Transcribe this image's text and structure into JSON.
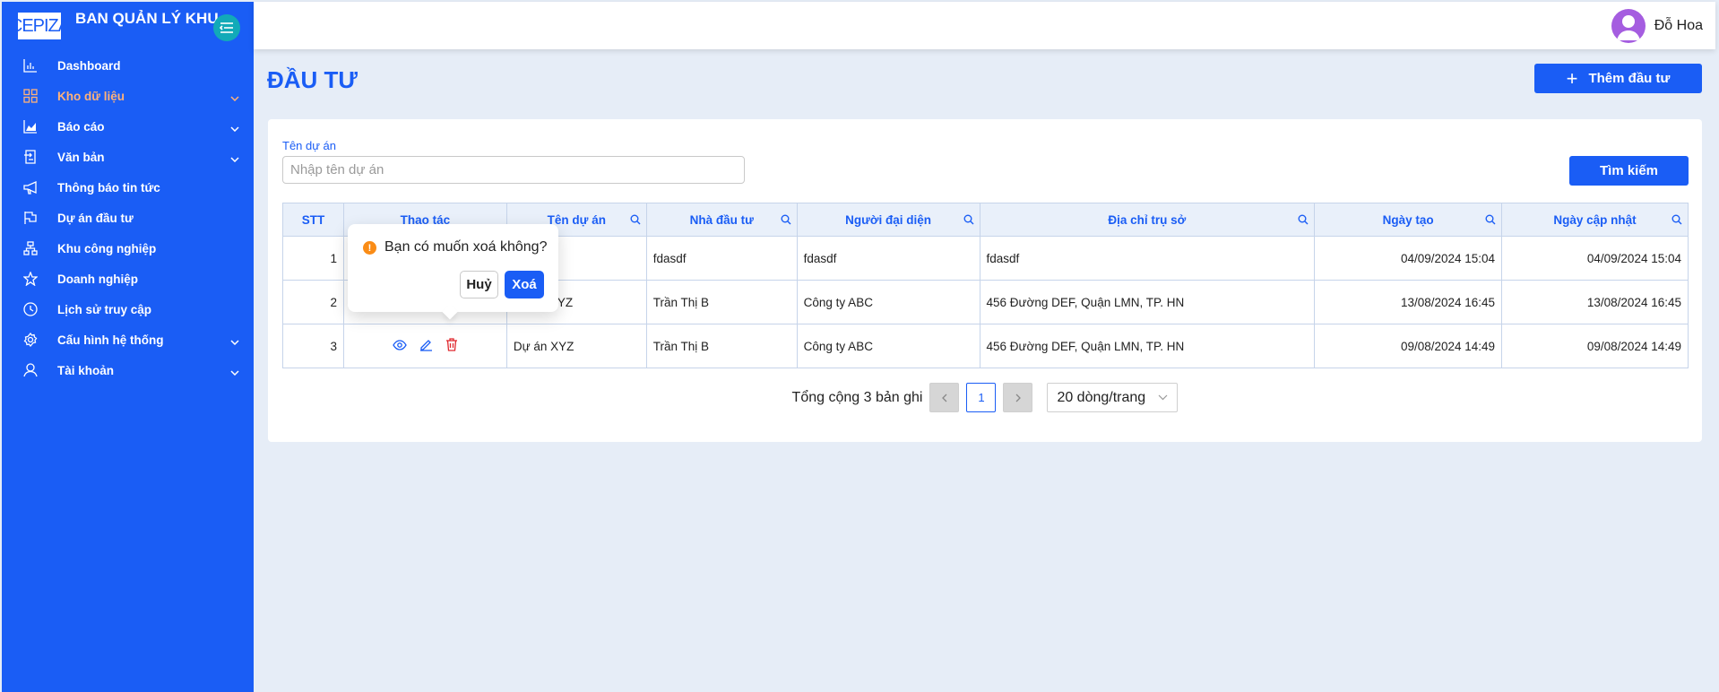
{
  "sidebar": {
    "logo_text": "CEPIZA",
    "brand_title": "BAN QUẢN LÝ KHU CHẾ XUẤT KHU CN",
    "items": [
      {
        "label": "Dashboard",
        "icon": "bar-chart-icon"
      },
      {
        "label": "Kho dữ liệu",
        "icon": "grid-icon",
        "active": true
      },
      {
        "label": "Báo cáo",
        "icon": "area-chart-icon"
      },
      {
        "label": "Văn bản",
        "icon": "document-icon"
      },
      {
        "label": "Thông báo tin tức",
        "icon": "megaphone-icon"
      },
      {
        "label": "Dự án đầu tư",
        "icon": "flag-icon"
      },
      {
        "label": "Khu công nghiệp",
        "icon": "cluster-icon"
      },
      {
        "label": "Doanh nghiệp",
        "icon": "star-icon"
      },
      {
        "label": "Lịch sử truy cập",
        "icon": "clock-icon"
      },
      {
        "label": "Cấu hình hệ thống",
        "icon": "gear-icon"
      },
      {
        "label": "Tài khoản",
        "icon": "user-icon"
      }
    ],
    "accent_color": "#1a5df5",
    "active_color": "#ffb27a"
  },
  "header": {
    "user_name": "Đỗ Hoa"
  },
  "page": {
    "title": "ĐẦU TƯ",
    "add_button": "Thêm đầu tư"
  },
  "filter": {
    "label": "Tên dự án",
    "placeholder": "Nhập tên dự án",
    "value": "",
    "search_button": "Tìm kiếm"
  },
  "table": {
    "columns": [
      "STT",
      "Thao tác",
      "Tên dự án",
      "Nhà đầu tư",
      "Người đại diện",
      "Địa chỉ trụ sở",
      "Ngày tạo",
      "Ngày cập nhật"
    ],
    "rows": [
      {
        "stt": "1",
        "ten_du_an": "",
        "nha_dau_tu": "fdasdf",
        "nguoi_dai_dien": "fdasdf",
        "dia_chi": "fdasdf",
        "ngay_tao": "04/09/2024 15:04",
        "ngay_cap_nhat": "04/09/2024 15:04"
      },
      {
        "stt": "2",
        "ten_du_an": "YZ",
        "nha_dau_tu": "Trần Thị B",
        "nguoi_dai_dien": "Công ty ABC",
        "dia_chi": "456 Đường DEF, Quận LMN, TP. HN",
        "ngay_tao": "13/08/2024 16:45",
        "ngay_cap_nhat": "13/08/2024 16:45"
      },
      {
        "stt": "3",
        "ten_du_an": "Dự án XYZ",
        "nha_dau_tu": "Trần Thị B",
        "nguoi_dai_dien": "Công ty ABC",
        "dia_chi": "456 Đường DEF, Quận LMN, TP. HN",
        "ngay_tao": "09/08/2024 14:49",
        "ngay_cap_nhat": "09/08/2024 14:49"
      }
    ]
  },
  "popconfirm": {
    "message": "Bạn có muốn xoá không?",
    "cancel": "Huỷ",
    "ok": "Xoá"
  },
  "pagination": {
    "total_text": "Tổng cộng 3 bản ghi",
    "current_page": "1",
    "page_size": "20 dòng/trang"
  }
}
